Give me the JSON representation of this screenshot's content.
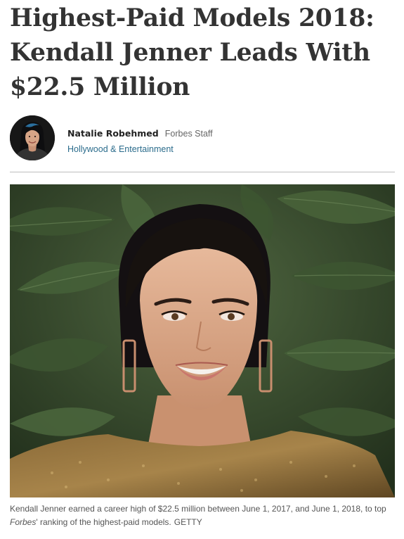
{
  "article": {
    "headline_lines": [
      "Highest-Paid Models 2018:",
      "Kendall Jenner Leads With",
      "$22.5 Million"
    ]
  },
  "author": {
    "name": "Natalie Robehmed",
    "role": "Forbes Staff",
    "section": "Hollywood & Entertainment"
  },
  "photo": {
    "caption_before": "Kendall Jenner earned a career high of $22.5 million between June 1, 2017, and June 1, 2018, to top ",
    "caption_publication": "Forbes",
    "caption_after": "' ranking of the highest-paid models.",
    "credit": "GETTY"
  }
}
